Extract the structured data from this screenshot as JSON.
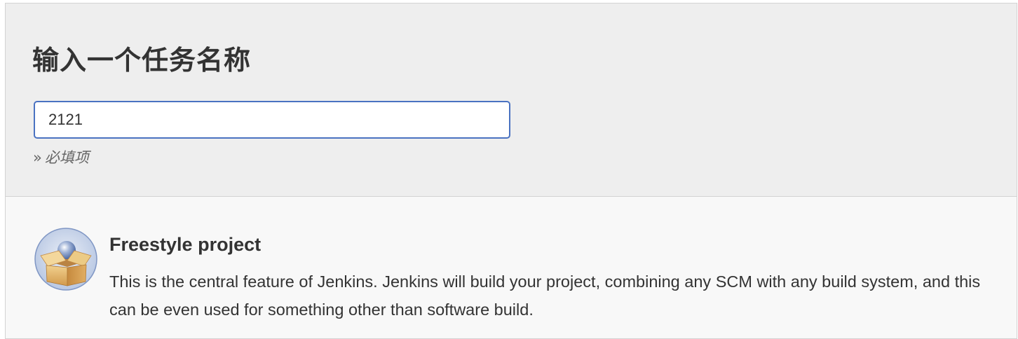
{
  "form": {
    "title": "输入一个任务名称",
    "name_value": "2121",
    "required_marker": "»",
    "required_text": "必填项"
  },
  "project_types": [
    {
      "icon": "freestyle-box-icon",
      "title": "Freestyle project",
      "description": "This is the central feature of Jenkins. Jenkins will build your project, combining any SCM with any build system, and this can be even used for something other than software build."
    }
  ],
  "colors": {
    "header_bg": "#eeeeee",
    "list_bg": "#f8f8f8",
    "input_focus_border": "#4a72c1",
    "text": "#333333",
    "hint_text": "#666666"
  }
}
